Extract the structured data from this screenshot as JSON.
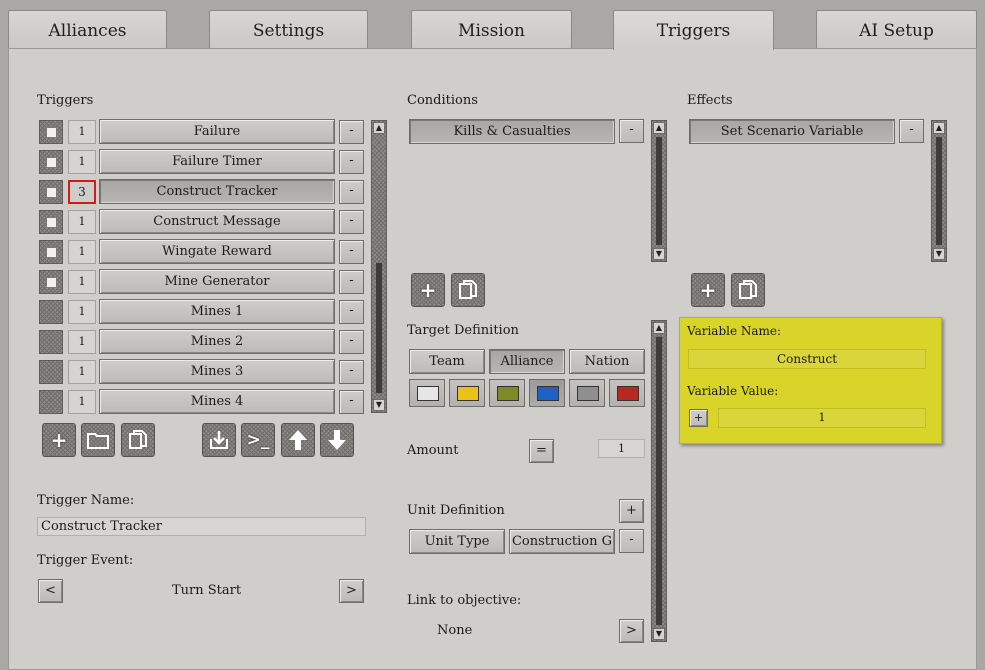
{
  "tabs": [
    {
      "label": "Alliances"
    },
    {
      "label": "Settings"
    },
    {
      "label": "Mission"
    },
    {
      "label": "Triggers"
    },
    {
      "label": "AI Setup"
    }
  ],
  "triggers": {
    "heading": "Triggers",
    "items": [
      {
        "num": "1",
        "name": "Failure",
        "checkbox": true
      },
      {
        "num": "1",
        "name": "Failure Timer",
        "checkbox": true
      },
      {
        "num": "3",
        "name": "Construct Tracker",
        "checkbox": true
      },
      {
        "num": "1",
        "name": "Construct Message",
        "checkbox": true
      },
      {
        "num": "1",
        "name": "Wingate Reward",
        "checkbox": true
      },
      {
        "num": "1",
        "name": "Mine Generator",
        "checkbox": true
      },
      {
        "num": "1",
        "name": "Mines 1",
        "checkbox": false
      },
      {
        "num": "1",
        "name": "Mines 2",
        "checkbox": false
      },
      {
        "num": "1",
        "name": "Mines 3",
        "checkbox": false
      },
      {
        "num": "1",
        "name": "Mines 4",
        "checkbox": false
      }
    ],
    "remove_label": "-",
    "toolbar_icons": [
      "add-icon",
      "folder-icon",
      "copy-icon",
      "import-icon",
      "console-icon",
      "move-up-icon",
      "move-down-icon"
    ],
    "name_label": "Trigger Name:",
    "name_value": "Construct Tracker",
    "event_label": "Trigger Event:",
    "event_value": "Turn Start",
    "prev_label": "<",
    "next_label": ">"
  },
  "conditions": {
    "heading": "Conditions",
    "items": [
      {
        "name": "Kills & Casualties"
      }
    ],
    "remove_label": "-",
    "target_label": "Target Definition",
    "target_tabs": [
      "Team",
      "Alliance",
      "Nation"
    ],
    "swatches": [
      "#e6e6e6",
      "#e9c21a",
      "#7e8a26",
      "#2062c4",
      "#8f8f8f",
      "#b42a22"
    ],
    "amount_label": "Amount",
    "amount_operator": "=",
    "amount_value": "1",
    "unit_label": "Unit Definition",
    "unit_add": "+",
    "unit_type_label": "Unit Type",
    "unit_type_value": "Construction G",
    "unit_remove": "-",
    "link_label": "Link to objective:",
    "link_value": "None",
    "link_next": ">"
  },
  "effects": {
    "heading": "Effects",
    "items": [
      {
        "name": "Set Scenario Variable"
      }
    ],
    "remove_label": "-",
    "variable_name_label": "Variable Name:",
    "variable_name_value": "Construct",
    "variable_value_label": "Variable Value:",
    "variable_op": "+",
    "variable_value": "1",
    "highlight_color": "#d8d42a"
  }
}
